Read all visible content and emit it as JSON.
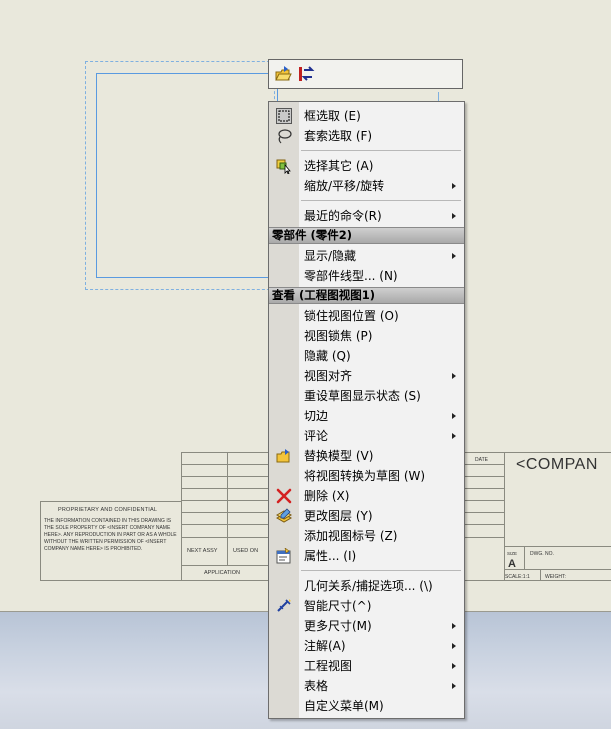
{
  "title_block": {
    "proprietary_title": "PROPRIETARY AND CONFIDENTIAL",
    "proprietary_body": "THE INFORMATION CONTAINED IN THIS DRAWING IS THE SOLE PROPERTY OF <INSERT COMPANY NAME HERE>. ANY REPRODUCTION IN PART OR AS A WHOLE WITHOUT THE WRITTEN PERMISSION OF <INSERT COMPANY NAME HERE> IS PROHIBITED.",
    "next_assy": "NEXT ASSY",
    "used_on": "USED ON",
    "application": "APPLICATION",
    "date": "DATE",
    "company": "<COMPAN",
    "size_label": "SIZE",
    "size_value": "A",
    "dwg_no": "DWG. NO.",
    "scale": "SCALE:1:1",
    "weight": "WEIGHT:"
  },
  "mini_toolbar": {
    "buttons": [
      {
        "icon": "open-part-icon"
      },
      {
        "icon": "rebuild-icon"
      }
    ]
  },
  "menu": {
    "items": [
      {
        "label": "框选取 (E)",
        "icon": "box-select-icon"
      },
      {
        "label": "套索选取 (F)",
        "icon": "lasso-select-icon"
      },
      {
        "label": "选择其它 (A)",
        "icon": "select-other-icon"
      },
      {
        "label": "缩放/平移/旋转",
        "submenu": true
      },
      {
        "label": "最近的命令(R)",
        "submenu": true
      },
      {
        "header": "零部件 (零件2)"
      },
      {
        "label": "显示/隐藏",
        "submenu": true
      },
      {
        "label": "零部件线型... (N)"
      },
      {
        "header": "查看 (工程图视图1)"
      },
      {
        "label": "锁住视图位置 (O)"
      },
      {
        "label": "视图锁焦 (P)"
      },
      {
        "label": "隐藏 (Q)"
      },
      {
        "label": "视图对齐",
        "submenu": true
      },
      {
        "label": "重设草图显示状态 (S)"
      },
      {
        "label": "切边",
        "submenu": true
      },
      {
        "label": "评论",
        "submenu": true
      },
      {
        "label": "替换模型 (V)",
        "icon": "replace-model-icon"
      },
      {
        "label": "将视图转换为草图 (W)"
      },
      {
        "label": "删除 (X)",
        "icon": "delete-icon"
      },
      {
        "label": "更改图层 (Y)",
        "icon": "change-layer-icon"
      },
      {
        "label": "添加视图标号 (Z)"
      },
      {
        "label": "属性... (I)",
        "icon": "properties-icon"
      },
      {
        "label": "几何关系/捕捉选项... (\\)"
      },
      {
        "label": "智能尺寸(^)",
        "icon": "smart-dimension-icon"
      },
      {
        "label": "更多尺寸(M)",
        "submenu": true
      },
      {
        "label": "注解(A)",
        "submenu": true
      },
      {
        "label": "工程视图",
        "submenu": true
      },
      {
        "label": "表格",
        "submenu": true
      },
      {
        "label": "自定义菜单(M)"
      }
    ]
  },
  "colors": {
    "sheet": "#e9e8dc",
    "selection": "#5a9ae0",
    "menu_bg": "#f2f2f2",
    "menu_header": "#b5b5b5",
    "delete_red": "#d42020"
  }
}
